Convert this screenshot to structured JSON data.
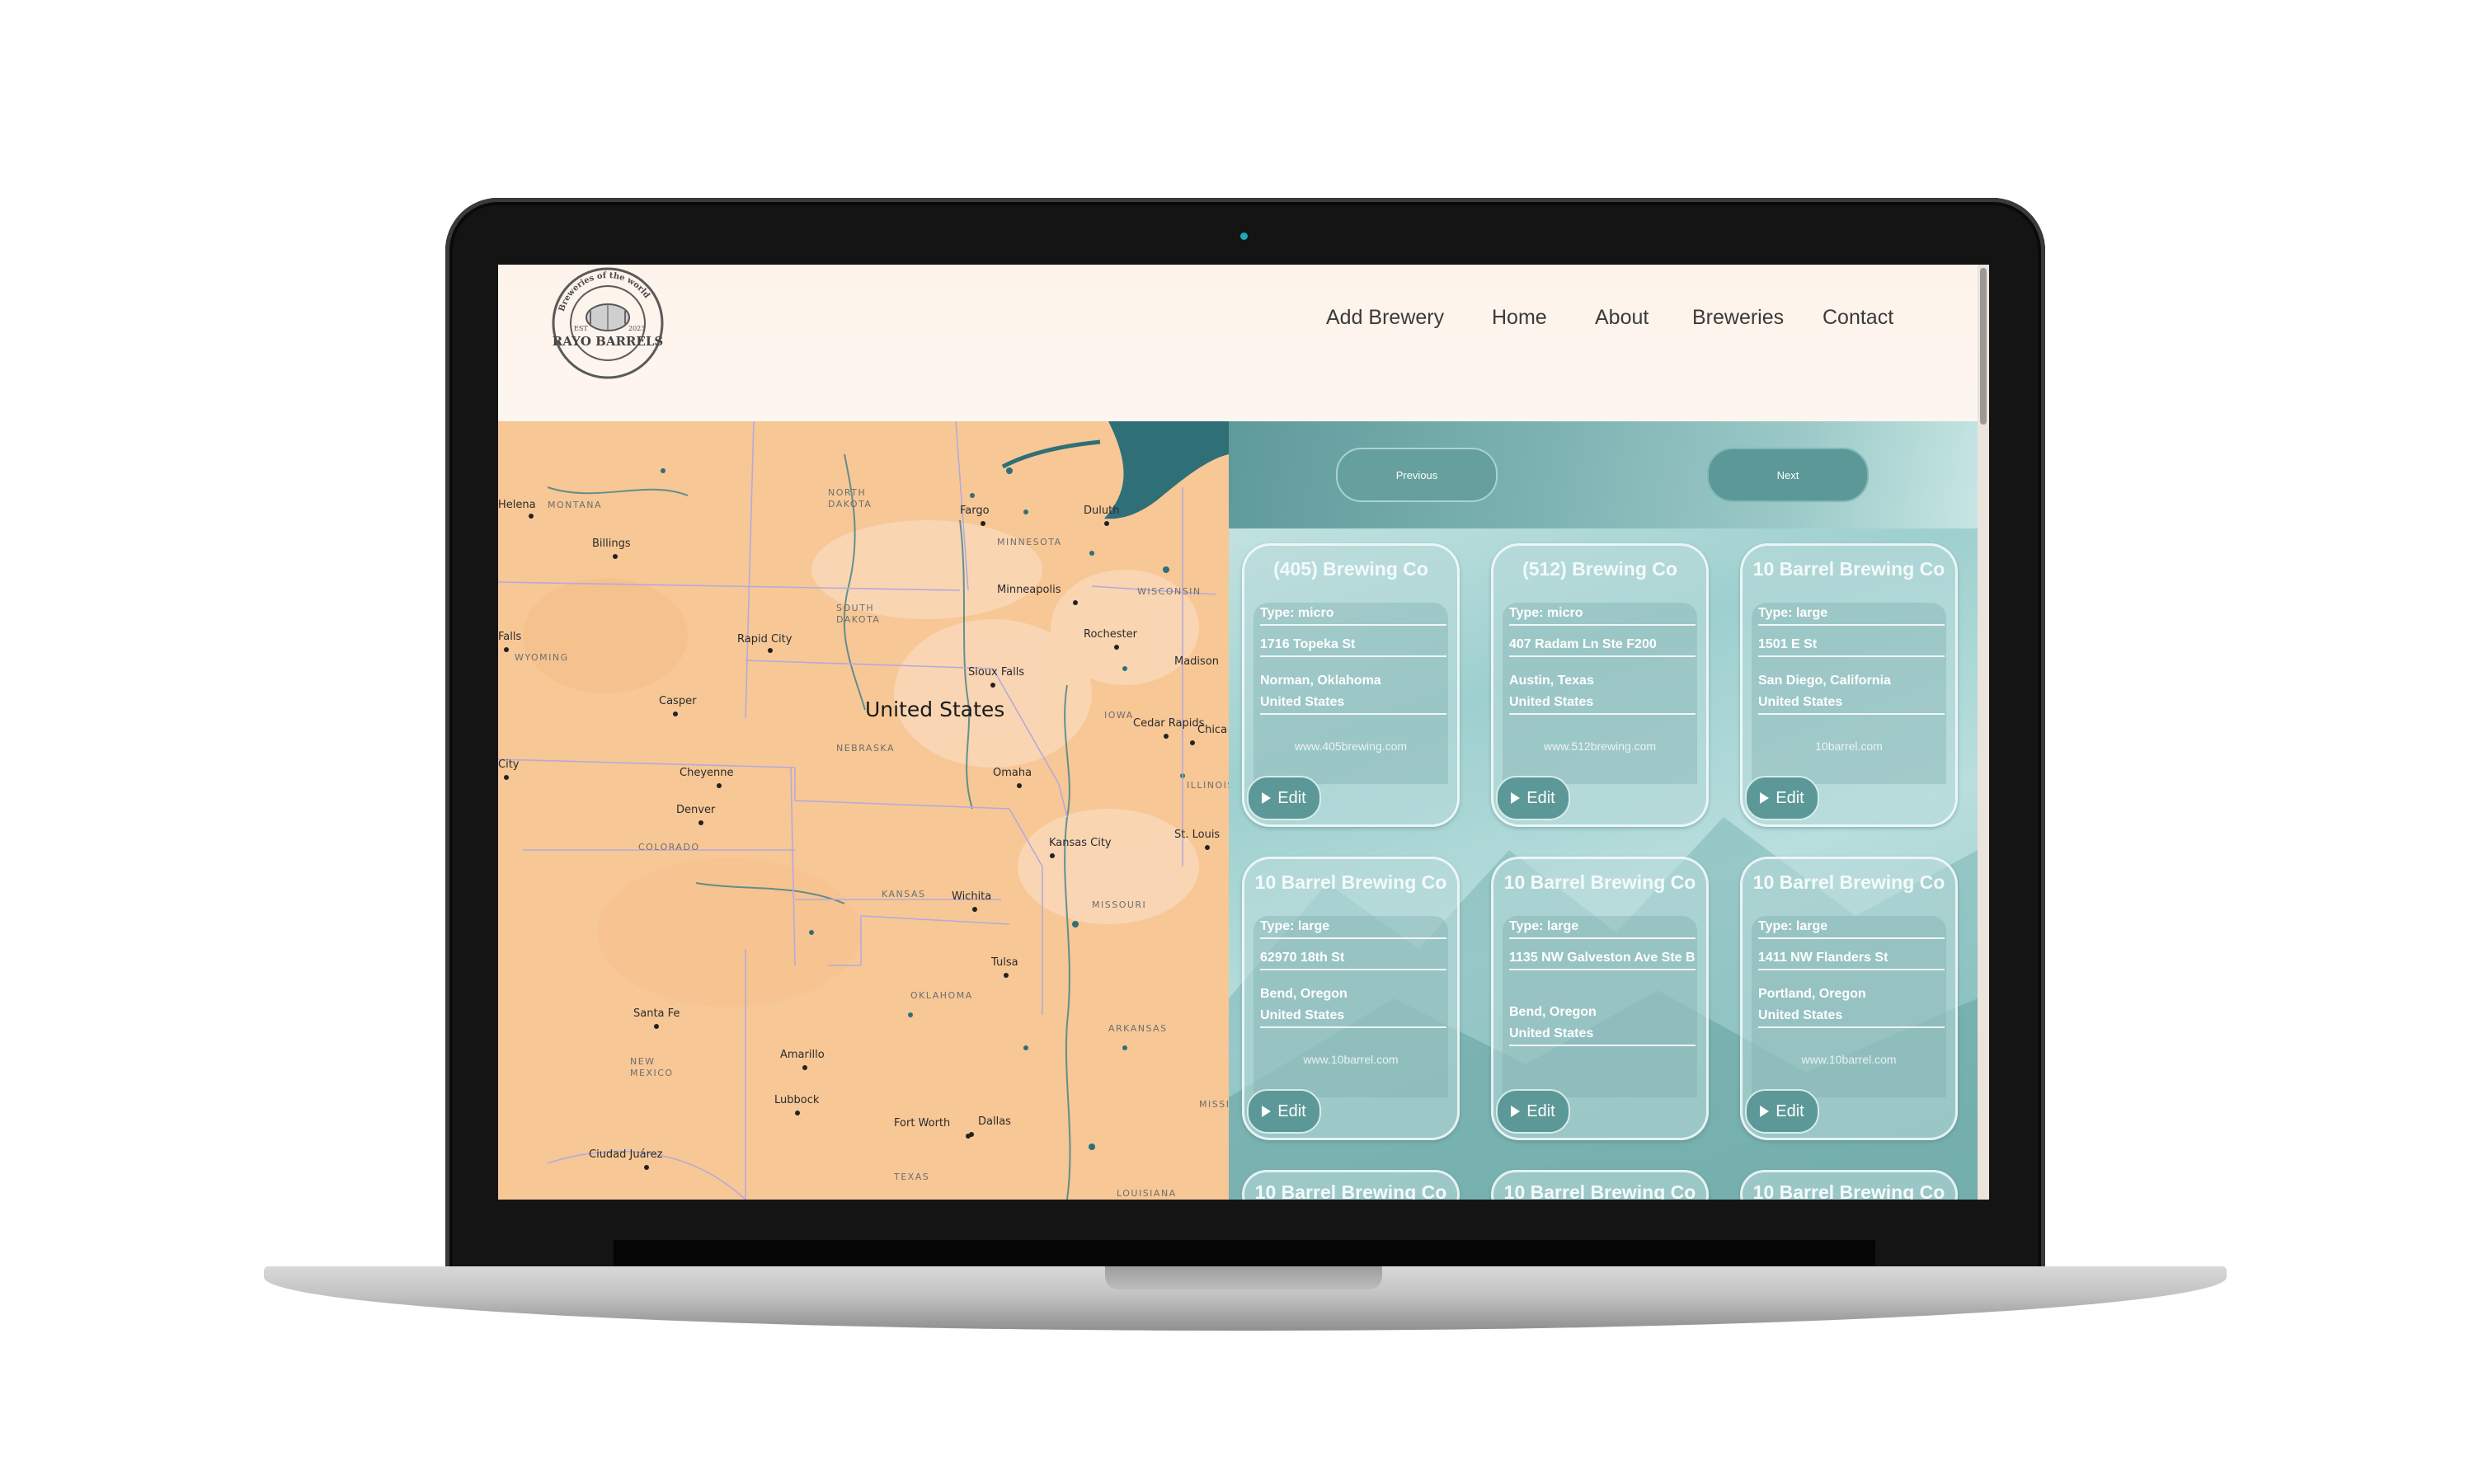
{
  "brand": {
    "name": "RAYO BARRELS",
    "ring_text": "Breweries of the world",
    "est": "EST",
    "year": "2023"
  },
  "nav": [
    "Add Brewery",
    "Home",
    "About",
    "Breweries",
    "Contact"
  ],
  "map": {
    "country_label": "United States",
    "states": [
      "MONTANA",
      "NORTH DAKOTA",
      "SOUTH DAKOTA",
      "WYOMING",
      "NEBRASKA",
      "MINNESOTA",
      "WISCONSIN",
      "IOWA",
      "COLORADO",
      "KANSAS",
      "MISSOURI",
      "OKLAHOMA",
      "ARKANSAS",
      "NEW MEXICO",
      "TEXAS",
      "LOUISIANA",
      "ILLINOIS",
      "MISSI"
    ],
    "cities": [
      "Helena",
      "Billings",
      "Fargo",
      "Duluth",
      "Minneapolis",
      "Rapid City",
      "Rochester",
      "Madison",
      "Sioux Falls",
      "Casper",
      "Cedar Rapids",
      "Chica",
      "Cheyenne",
      "Omaha",
      "Denver",
      "Kansas City",
      "St. Louis",
      "Wichita",
      "Tulsa",
      "Santa Fe",
      "Amarillo",
      "Lubbock",
      "Fort Worth",
      "Dallas",
      "Ciudad Juárez",
      "Falls",
      "City"
    ],
    "colors": {
      "land": "#f7c796",
      "water": "#2f6f78",
      "border": "#b6aadb"
    }
  },
  "pager": {
    "previous": "Previous",
    "next": "Next"
  },
  "edit_label": "Edit",
  "breweries": [
    {
      "name": "(405) Brewing Co",
      "type": "Type: micro",
      "street": "1716 Topeka St",
      "city": "Norman, Oklahoma",
      "country": "United States",
      "website": "www.405brewing.com"
    },
    {
      "name": "(512) Brewing Co",
      "type": "Type: micro",
      "street": "407 Radam Ln Ste F200",
      "city": "Austin, Texas",
      "country": "United States",
      "website": "www.512brewing.com"
    },
    {
      "name": "10 Barrel Brewing Co",
      "type": "Type: large",
      "street": "1501 E St",
      "city": "San Diego, California",
      "country": "United States",
      "website": "10barrel.com"
    },
    {
      "name": "10 Barrel Brewing Co",
      "type": "Type: large",
      "street": "62970 18th St",
      "city": "Bend, Oregon",
      "country": "United States",
      "website": "www.10barrel.com"
    },
    {
      "name": "10 Barrel Brewing Co",
      "type": "Type: large",
      "street": "1135 NW Galveston Ave Ste B",
      "city": "Bend, Oregon",
      "country": "United States",
      "website": ""
    },
    {
      "name": "10 Barrel Brewing Co",
      "type": "Type: large",
      "street": "1411 NW Flanders St",
      "city": "Portland, Oregon",
      "country": "United States",
      "website": "www.10barrel.com"
    },
    {
      "name": "10 Barrel Brewing Co"
    },
    {
      "name": "10 Barrel Brewing Co"
    },
    {
      "name": "10 Barrel Brewing Co"
    }
  ]
}
